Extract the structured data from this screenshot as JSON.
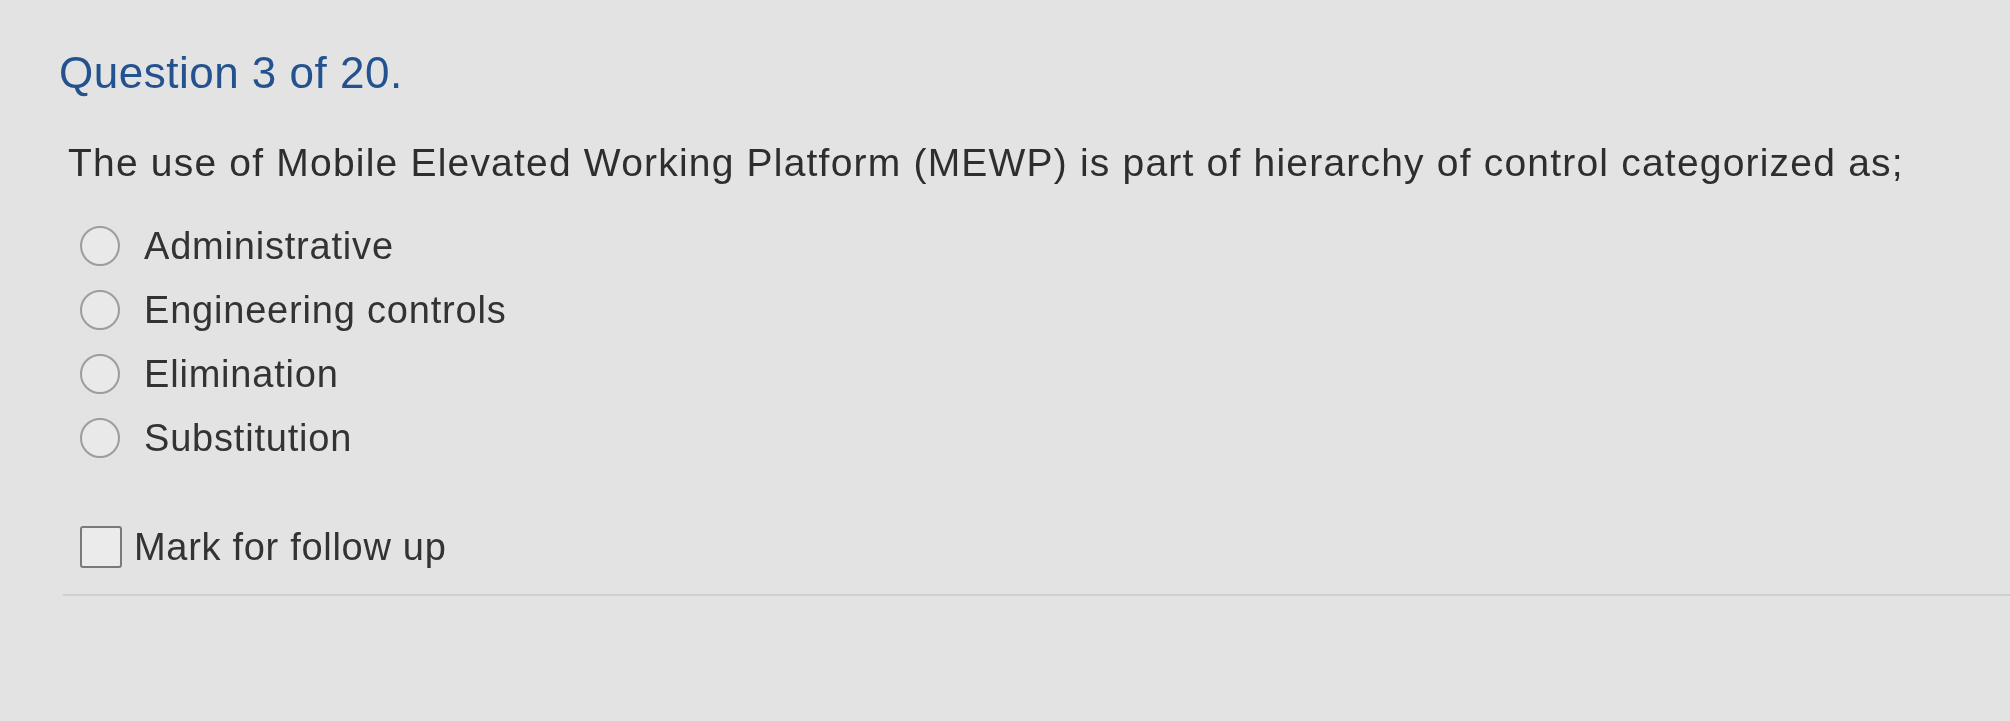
{
  "question": {
    "title": "Question 3 of 20.",
    "text": "The use of Mobile Elevated Working Platform (MEWP) is part of hierarchy of control categorized as;"
  },
  "options": [
    {
      "label": "Administrative",
      "selected": false
    },
    {
      "label": "Engineering controls",
      "selected": false
    },
    {
      "label": "Elimination",
      "selected": false
    },
    {
      "label": "Substitution",
      "selected": false
    }
  ],
  "follow_up": {
    "label": "Mark for follow up",
    "checked": false
  }
}
